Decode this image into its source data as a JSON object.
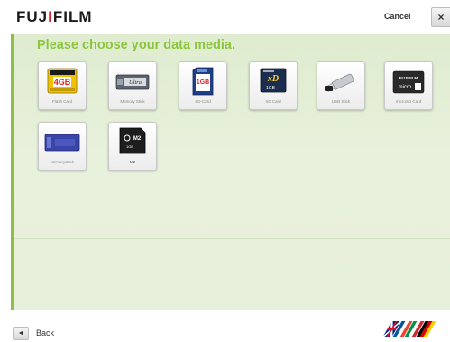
{
  "header": {
    "logo_left": "FUJ",
    "logo_accent": "I",
    "logo_right": "FILM",
    "cancel_label": "Cancel",
    "close_glyph": "×"
  },
  "main": {
    "title": "Please choose your data media.",
    "media": [
      {
        "label": "Flash Card",
        "icon": "compact-flash-card-icon",
        "card_text": "4GB"
      },
      {
        "label": "Memory Stick",
        "icon": "memory-stick-pro-icon",
        "card_text": "Ultra"
      },
      {
        "label": "SD-Card",
        "icon": "sd-card-icon",
        "card_text": "1GB"
      },
      {
        "label": "XD Card",
        "icon": "xd-card-icon",
        "card_text": "1GB"
      },
      {
        "label": "USB Stick",
        "icon": "usb-stick-icon"
      },
      {
        "label": "microSD Card",
        "icon": "microsd-card-icon",
        "card_text": "FUJIFILM"
      },
      {
        "label": "MemoryStick",
        "icon": "memory-stick-icon"
      },
      {
        "label": "M2",
        "icon": "m2-card-icon",
        "card_text": "M2"
      }
    ]
  },
  "footer": {
    "back_glyph": "◄",
    "back_label": "Back",
    "flags_icon": "language-flags-icon"
  },
  "colors": {
    "accent_green": "#8cc63f",
    "panel_bg": "#e4efd6",
    "logo_red": "#d2232a"
  }
}
